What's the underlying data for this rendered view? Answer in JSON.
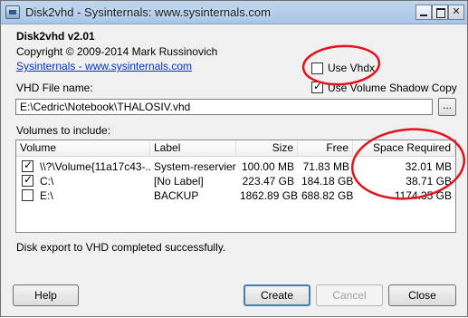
{
  "window": {
    "title": "Disk2vhd - Sysinternals: www.sysinternals.com"
  },
  "header": {
    "app_version": "Disk2vhd v2.01",
    "copyright": "Copyright  © 2009-2014 Mark Russinovich",
    "link": "Sysinternals - www.sysinternals.com"
  },
  "options": {
    "use_vhdx_label": "Use Vhdx",
    "use_vhdx_checked": false,
    "vss_label": "Use Volume Shadow Copy",
    "vss_checked": true
  },
  "vhd_file": {
    "label": "VHD File name:",
    "value": "E:\\Cedric\\Notebook\\THALOSIV.vhd",
    "browse_label": "..."
  },
  "volumes": {
    "label": "Volumes to include:",
    "columns": {
      "volume": "Volume",
      "label": "Label",
      "size": "Size",
      "free": "Free",
      "space_required": "Space Required"
    },
    "rows": [
      {
        "checked": true,
        "volume": "\\\\?\\Volume{11a17c43-...",
        "label": "System-reserviert",
        "size": "100.00 MB",
        "free": "71.83 MB",
        "space_required": "32.01 MB"
      },
      {
        "checked": true,
        "volume": "C:\\",
        "label": "[No Label]",
        "size": "223.47 GB",
        "free": "184.18 GB",
        "space_required": "38.71 GB"
      },
      {
        "checked": false,
        "volume": "E:\\",
        "label": "BACKUP",
        "size": "1862.89 GB",
        "free": "688.82 GB",
        "space_required": "1174.35 GB"
      }
    ]
  },
  "status": "Disk export to VHD completed successfully.",
  "buttons": {
    "help": "Help",
    "create": "Create",
    "cancel": "Cancel",
    "close": "Close"
  },
  "colors": {
    "annotation": "#e3121b",
    "link": "#0033cc"
  }
}
